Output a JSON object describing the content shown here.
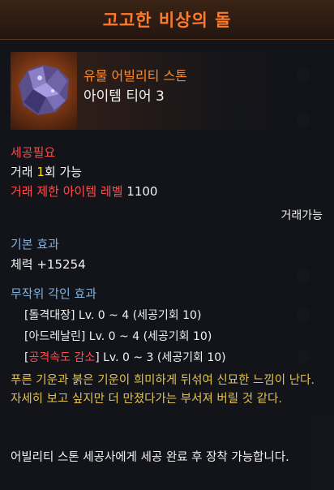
{
  "title": "고고한 비상의 돌",
  "item": {
    "grade": "유물 어빌리티 스톤",
    "tier": "아이템 티어 3",
    "icon": "amethyst-stone-icon"
  },
  "requirements": {
    "header": "세공필요",
    "trade_prefix": "거래 ",
    "trade_count": "1",
    "trade_suffix": "회 가능",
    "level_label": "거래 제한 아이템 레벨",
    "level_value": "1100",
    "tradeable": "거래가능"
  },
  "base_effect": {
    "header": "기본 효과",
    "stat": "체력 +15254"
  },
  "random_engraving": {
    "header": "무작위 각인 효과",
    "items": [
      {
        "name": "돌격대장",
        "text": "] Lv. 0 ~ 4 (세공기회 10)",
        "negative": false
      },
      {
        "name": "아드레날린",
        "text": "] Lv. 0 ~ 4 (세공기회 10)",
        "negative": false
      },
      {
        "name": "공격속도 감소",
        "text": "] Lv. 0 ~ 3 (세공기회 10)",
        "negative": true
      }
    ]
  },
  "flavor_text": "푸른 기운과 붉은 기운이 희미하게 뒤섞여 신묘한 느낌이 난다. 자세히 보고 싶지만 더 만졌다가는 부서져 버릴 것 같다.",
  "notice_text": "어빌리티 스톤 세공사에게 세공 완료 후 장착 가능합니다.",
  "colors": {
    "title": "#ff7a2a",
    "grade": "#ff8a2a",
    "warning": "#ff4a4a",
    "section": "#7fb2e0",
    "highlight": "#ffe000",
    "flavor": "#e3c34f"
  }
}
